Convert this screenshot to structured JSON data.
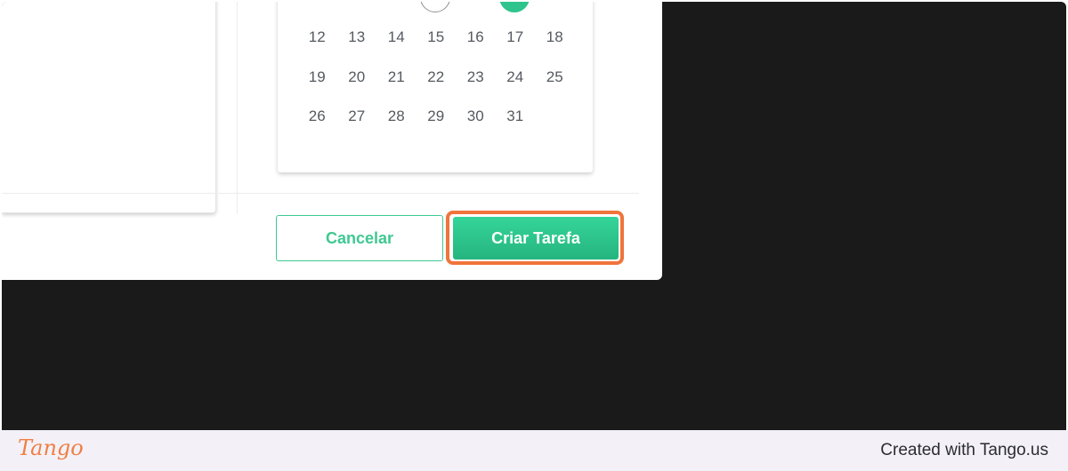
{
  "calendar": {
    "weeks": [
      [
        "12",
        "13",
        "14",
        "15",
        "16",
        "17",
        "18"
      ],
      [
        "19",
        "20",
        "21",
        "22",
        "23",
        "24",
        "25"
      ],
      [
        "26",
        "27",
        "28",
        "29",
        "30",
        "31",
        ""
      ]
    ]
  },
  "actions": {
    "cancel_label": "Cancelar",
    "create_label": "Criar Tarefa"
  },
  "footer": {
    "logo_text": "Tango",
    "credit": "Created with Tango.us"
  },
  "colors": {
    "accent_green": "#2fc48d",
    "highlight_orange": "#f0743c",
    "backdrop": "#1a1a1a"
  }
}
